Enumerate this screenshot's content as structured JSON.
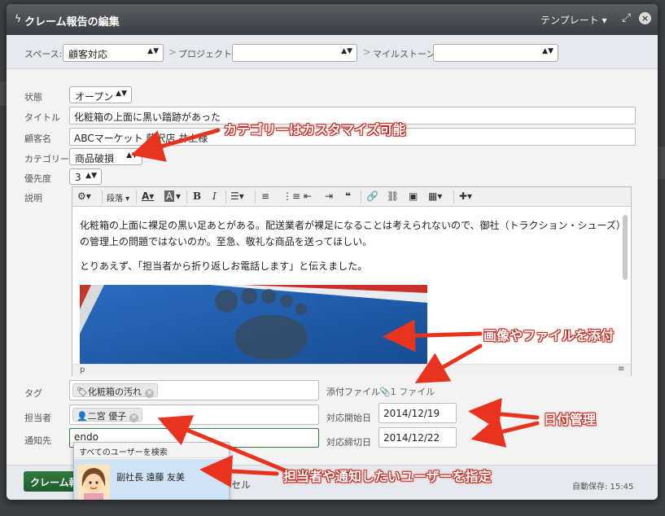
{
  "window": {
    "title": "クレーム報告の編集",
    "template_label": "テンプレート",
    "expand_icon": "expand-icon",
    "close_icon": "close-icon"
  },
  "spacebar": {
    "space_label": "スペース:",
    "space_value": "顧客対応",
    "project_label": "プロジェクト",
    "project_value": "",
    "milestone_label": "マイルストーン",
    "milestone_value": ""
  },
  "form": {
    "status_label": "状態",
    "status_value": "オープン",
    "title_label": "タイトル",
    "title_value": "化粧箱の上面に黒い踏跡があった",
    "customer_label": "顧客名",
    "customer_value": "ABCマーケット 藤沢店 井上様",
    "category_label": "カテゴリー",
    "category_value": "商品破損",
    "priority_label": "優先度",
    "priority_value": "3",
    "description_label": "説明",
    "tag_label": "タグ",
    "tag_value": "化粧箱の汚れ",
    "assignee_label": "担当者",
    "assignee_value": "二宮 優子",
    "notify_label": "通知先",
    "notify_value": "endo",
    "attachment_label": "添付ファイル",
    "attachment_value": "1 ファイル",
    "start_label": "対応開始日",
    "start_value": "2014/12/19",
    "due_label": "対応締切日",
    "due_value": "2014/12/22"
  },
  "editor": {
    "toolbar": {
      "paragraph_label": "段落",
      "icons": [
        "gear-icon",
        "font-color-icon",
        "highlight-icon",
        "bold-icon",
        "italic-icon",
        "align-icon",
        "bullet-list-icon",
        "numbered-list-icon",
        "outdent-icon",
        "indent-icon",
        "quote-icon",
        "link-icon",
        "unlink-icon",
        "image-icon",
        "table-icon",
        "plugin-icon"
      ]
    },
    "paragraph1_line1": "化粧箱の上面に裸足の黒い足あとがある。配送業者が裸足になることは考えられないので、御社（トラクション・シューズ）",
    "paragraph1_line2": "の管理上の問題ではないのか。至急、敬礼な商品を送ってほしい。",
    "paragraph2": "とりあえず、「担当者から折り返しお電話します」と伝えました。",
    "status_path": "p"
  },
  "user_dropdown": {
    "header": "すべてのユーザーを検索",
    "user_name": "副社長 遠藤 友美"
  },
  "footer": {
    "save_label": "クレーム報告を保存",
    "cancel_label": "セル",
    "autosave": "自動保存: 15:45"
  },
  "annotations": {
    "category_note": "カテゴリーはカスタマイズ可能",
    "attach_note": "画像やファイルを添付",
    "date_note": "日付管理",
    "user_note": "担当者や通知したいユーザーを指定"
  },
  "colors": {
    "accent_green": "#2f7a3f",
    "annotation_red": "#e8331f",
    "titlebar": "#45484c"
  }
}
